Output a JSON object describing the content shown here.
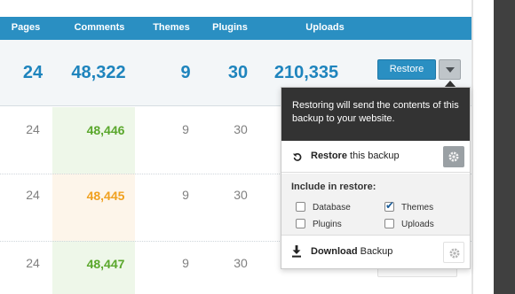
{
  "table": {
    "headers": [
      "Pages",
      "Comments",
      "Themes",
      "Plugins",
      "Uploads"
    ],
    "summary": [
      "24",
      "48,322",
      "9",
      "30",
      "210,335"
    ],
    "rows": [
      {
        "pages": "24",
        "comments": "48,446",
        "themes": "9",
        "plugins": "30"
      },
      {
        "pages": "24",
        "comments": "48,445",
        "themes": "9",
        "plugins": "30"
      },
      {
        "pages": "24",
        "comments": "48,447",
        "themes": "9",
        "plugins": "30"
      }
    ]
  },
  "actions": {
    "restore_label": "Restore"
  },
  "popover": {
    "message": "Restoring will send the contents of this backup to your website.",
    "restore_bold": "Restore",
    "restore_rest": " this backup",
    "include_title": "Include in restore:",
    "options": [
      {
        "label": "Database",
        "checked": false
      },
      {
        "label": "Themes",
        "checked": true
      },
      {
        "label": "Plugins",
        "checked": false
      },
      {
        "label": "Uploads",
        "checked": false
      }
    ],
    "download_bold": "Download",
    "download_rest": " Backup"
  },
  "colors": {
    "accent": "#2a8fc2",
    "positive": "#5aa72c",
    "warning": "#f0a120",
    "popover_head": "#333333"
  },
  "icons": {
    "restore": "undo-icon",
    "download": "download-icon",
    "settings": "gear-icon",
    "toggle": "chevron-down-icon"
  }
}
